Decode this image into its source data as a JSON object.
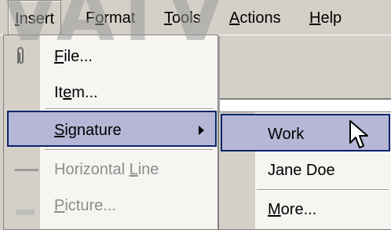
{
  "menubar": {
    "items": [
      {
        "label": "Insert",
        "accel": "I",
        "rest": "nsert"
      },
      {
        "label": "Format",
        "accel": "o",
        "pre": "F",
        "rest": "rmat"
      },
      {
        "label": "Tools",
        "accel": "T",
        "rest": "ools"
      },
      {
        "label": "Actions",
        "accel": "A",
        "rest": "ctions"
      },
      {
        "label": "Help",
        "accel": "H",
        "rest": "elp"
      }
    ]
  },
  "insert_menu": {
    "items": [
      {
        "label": "File...",
        "accel": "F",
        "rest": "ile...",
        "icon": "paperclip-icon",
        "enabled": true
      },
      {
        "label": "Item...",
        "pre": "It",
        "accel": "e",
        "rest": "m...",
        "enabled": true
      },
      {
        "label": "Signature",
        "accel": "S",
        "rest": "ignature",
        "has_submenu": true,
        "highlighted": true,
        "enabled": true
      },
      {
        "label": "Horizontal Line",
        "pre": "Horizontal ",
        "accel": "L",
        "rest": "ine",
        "icon": "horizontal-line-icon",
        "enabled": false
      },
      {
        "label": "Picture...",
        "accel": "P",
        "rest": "icture...",
        "icon": "picture-icon",
        "enabled": false
      }
    ]
  },
  "signature_submenu": {
    "items": [
      {
        "label": "Work",
        "highlighted": true
      },
      {
        "label": "Jane Doe"
      },
      {
        "label": "More...",
        "accel": "M",
        "rest": "ore..."
      }
    ]
  },
  "watermark": "VATV",
  "colors": {
    "menu_bg": "#d4d0c8",
    "menu_surface": "#f6f5f2",
    "highlight_bg": "#b6b6d6",
    "highlight_border": "#0a246a",
    "disabled_text": "#8c8c8c"
  }
}
